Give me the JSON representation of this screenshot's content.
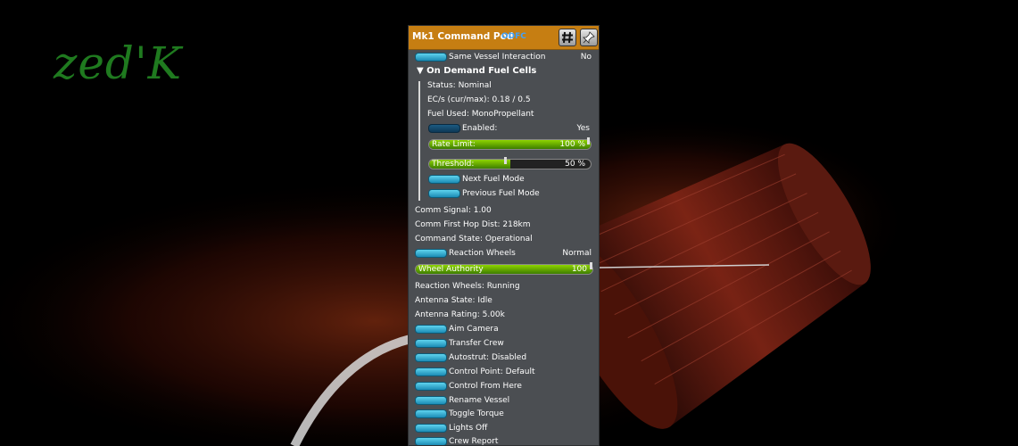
{
  "logo": "zed'K",
  "window": {
    "title": "Mk1 Command Pod",
    "tag": "ODFC",
    "pin_icon": "pin-icon",
    "hash_icon": "hash-icon"
  },
  "rows": {
    "same_vessel_label": "Same Vessel Interaction",
    "same_vessel_value": "No",
    "section_title": "On Demand Fuel Cells",
    "status": "Status: Nominal",
    "ecs": "EC/s (cur/max): 0.18 / 0.5",
    "fuel_used": "Fuel Used: MonoPropellant",
    "enabled_label": "Enabled:",
    "enabled_value": "Yes",
    "rate_limit_label": "Rate Limit:",
    "rate_limit_value": "100 %",
    "rate_limit_level": 100,
    "threshold_label": "Threshold:",
    "threshold_value": "50 %",
    "threshold_level": 50,
    "next_fuel_mode": "Next Fuel Mode",
    "prev_fuel_mode": "Previous Fuel Mode",
    "comm_signal": "Comm Signal: 1.00",
    "comm_first_hop": "Comm First Hop Dist: 218km",
    "command_state": "Command State: Operational",
    "reaction_wheels_label": "Reaction Wheels",
    "reaction_wheels_value": "Normal",
    "wheel_authority_label": "Wheel Authority",
    "wheel_authority_value": "100",
    "wheel_authority_level": 100,
    "reaction_wheels_status": "Reaction Wheels: Running",
    "antenna_state": "Antenna State: Idle",
    "antenna_rating": "Antenna Rating: 5.00k",
    "aim_camera": "Aim Camera",
    "transfer_crew": "Transfer Crew",
    "autostrut": "Autostrut: Disabled",
    "control_point": "Control Point: Default",
    "control_from_here": "Control From Here",
    "rename_vessel": "Rename Vessel",
    "toggle_torque": "Toggle Torque",
    "lights_off": "Lights Off",
    "crew_report": "Crew Report"
  },
  "colors": {
    "header": "#c67e12",
    "panel": "#4b4e52",
    "accent_button": "#37b6dc",
    "slider_fill": "#6fb800",
    "tag": "#3ea2ff",
    "logo": "#1f7a1f"
  }
}
